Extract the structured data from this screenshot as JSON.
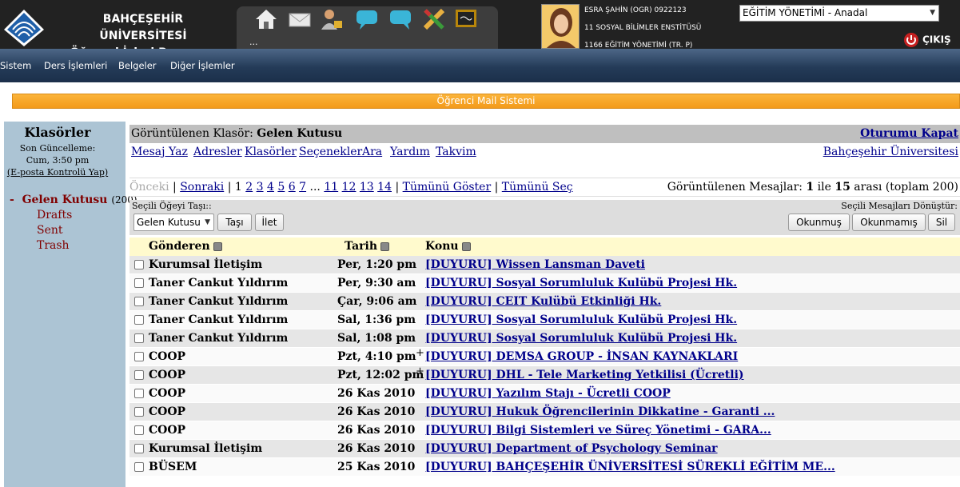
{
  "header": {
    "uni_line1": "BAHÇEŞEHİR ÜNİVERSİTESİ",
    "uni_line2": "Öğrenci İşleri Programı",
    "tool_dots": "...",
    "user_line1": "ESRA ŞAHİN (OGR) 0922123",
    "user_line2": "11 SOSYAL BİLİMLER ENSTİTÜSÜ",
    "user_line3": "1166 EĞİTİM YÖNETİMİ (TR. P)",
    "program_select": "EĞİTİM YÖNETİMİ - Anadal",
    "logout": "ÇIKIŞ"
  },
  "menu": [
    "Sistem",
    "Ders İşlemleri",
    "Belgeler",
    "Diğer İşlemler"
  ],
  "banner": "Öğrenci Mail Sistemi",
  "sidebar": {
    "title": "Klasörler",
    "last_update": "Son Güncelleme:",
    "last_time": "Cum, 3:50 pm",
    "check_mail": "(E-posta Kontrolü Yap)",
    "inbox_dash": "-",
    "inbox": "Gelen Kutusu",
    "inbox_count": "(200)",
    "drafts": "Drafts",
    "sent": "Sent",
    "trash": "Trash"
  },
  "main": {
    "viewing_prefix": "Görüntülenen Klasör:",
    "viewing_folder": "Gelen Kutusu",
    "logout_link": "Oturumu Kapat",
    "nav": [
      "Mesaj Yaz",
      "Adresler",
      "Klasörler",
      "Seçenekler",
      "Ara",
      "Yardım",
      "Takvim"
    ],
    "university_link": "Bahçeşehir Üniversitesi",
    "pager": {
      "prev": "Önceki",
      "next": "Sonraki",
      "current": "1",
      "pages": [
        "2",
        "3",
        "4",
        "5",
        "6",
        "7"
      ],
      "ellipsis": "...",
      "pages2": [
        "11",
        "12",
        "13",
        "14"
      ],
      "show_all": "Tümünü Göster",
      "select_all": "Tümünü Seç",
      "status_prefix": "Görüntülenen Mesajlar:",
      "status_from": "1",
      "status_mid": "ile",
      "status_to": "15",
      "status_suffix": "arası (toplam 200)"
    },
    "move_label": "Seçili Öğeyi Taşı::",
    "move_select": "Gelen Kutusu",
    "move_button": "Taşı",
    "forward_button": "İlet",
    "convert_label": "Seçili Mesajları Dönüştür:",
    "read_button": "Okunmuş",
    "unread_button": "Okunmamış",
    "delete_button": "Sil",
    "col_from": "Gönderen",
    "col_date": "Tarih",
    "col_subject": "Konu",
    "messages": [
      {
        "from": "Kurumsal İletişim",
        "date": "Per, 1:20 pm",
        "plus": "",
        "subject": "[DUYURU] Wissen Lansman Daveti"
      },
      {
        "from": "Taner Cankut Yıldırım",
        "date": "Per, 9:30 am",
        "plus": "",
        "subject": "[DUYURU] Sosyal Sorumluluk Kulübü Projesi Hk."
      },
      {
        "from": "Taner Cankut Yıldırım",
        "date": "Çar, 9:06 am",
        "plus": "",
        "subject": "[DUYURU] CEIT Kulübü Etkinliği Hk."
      },
      {
        "from": "Taner Cankut Yıldırım",
        "date": "Sal, 1:36 pm",
        "plus": "",
        "subject": "[DUYURU] Sosyal Sorumluluk Kulübü Projesi Hk."
      },
      {
        "from": "Taner Cankut Yıldırım",
        "date": "Sal, 1:08 pm",
        "plus": "",
        "subject": "[DUYURU] Sosyal Sorumluluk Kulübü Projesi Hk."
      },
      {
        "from": "COOP",
        "date": "Pzt, 4:10 pm",
        "plus": "+",
        "subject": "[DUYURU] DEMSA GROUP - İNSAN KAYNAKLARI"
      },
      {
        "from": "COOP",
        "date": "Pzt, 12:02 pm",
        "plus": "+",
        "subject": "[DUYURU] DHL - Tele Marketing Yetkilisi (Ücretli)"
      },
      {
        "from": "COOP",
        "date": "26 Kas 2010",
        "plus": "",
        "subject": "[DUYURU] Yazılım Stajı - Ücretli COOP"
      },
      {
        "from": "COOP",
        "date": "26 Kas 2010",
        "plus": "",
        "subject": "[DUYURU] Hukuk Öğrencilerinin Dikkatine - Garanti ..."
      },
      {
        "from": "COOP",
        "date": "26 Kas 2010",
        "plus": "",
        "subject": "[DUYURU] Bilgi Sistemleri ve Süreç Yönetimi - GARA..."
      },
      {
        "from": "Kurumsal İletişim",
        "date": "26 Kas 2010",
        "plus": "",
        "subject": "[DUYURU] Department of Psychology Seminar"
      },
      {
        "from": "BÜSEM",
        "date": "25 Kas 2010",
        "plus": "",
        "subject": "[DUYURU] BAHÇEŞEHİR ÜNİVERSİTESİ SÜREKLİ EĞİTİM ME..."
      }
    ]
  }
}
